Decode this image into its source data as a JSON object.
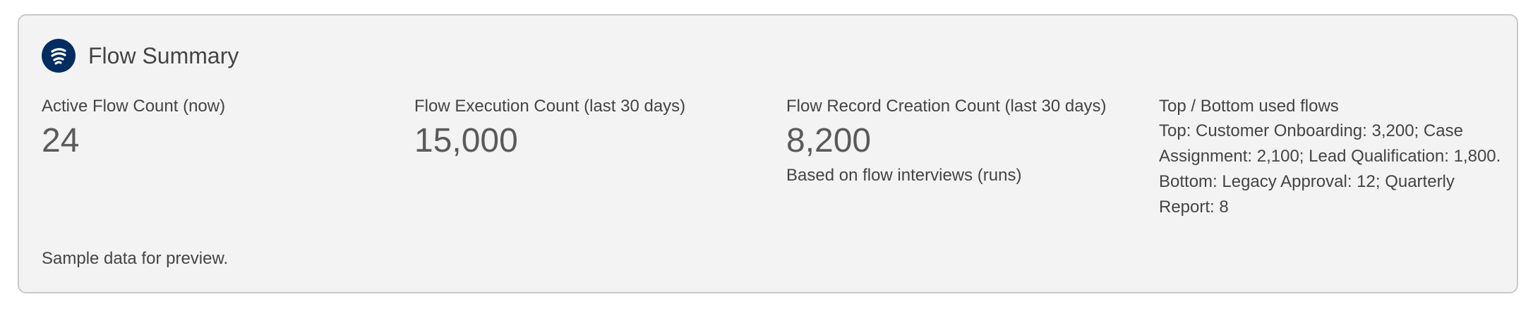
{
  "card": {
    "title": "Flow Summary",
    "icon": "flow-icon",
    "icon_bg": "#032d60"
  },
  "metrics": {
    "active": {
      "label": "Active Flow Count (now)",
      "value": "24"
    },
    "execution": {
      "label": "Flow Execution Count (last 30 days)",
      "value": "15,000"
    },
    "record": {
      "label": "Flow Record Creation Count (last 30 days)",
      "value": "8,200",
      "note": "Based on flow interviews (runs)"
    },
    "top_bottom": {
      "label": "Top / Bottom used flows",
      "text": "Top: Customer Onboarding: 3,200; Case Assignment: 2,100; Lead Qualification: 1,800. Bottom: Legacy Approval: 12; Quarterly Report: 8"
    }
  },
  "footer": {
    "text": "Sample data for preview."
  }
}
